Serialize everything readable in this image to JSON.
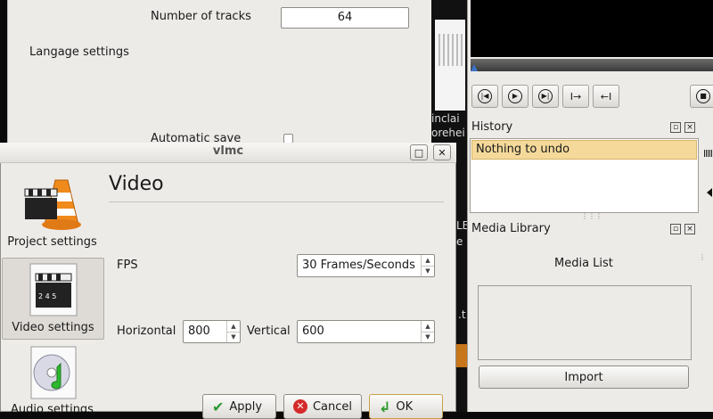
{
  "project_settings": {
    "tracks_label": "Number of tracks",
    "tracks_value": "64",
    "language_label": "Langage settings",
    "autosave_label": "Automatic save"
  },
  "background_fragments": [
    "inclai",
    "orehei",
    "LE",
    "e",
    ".t"
  ],
  "right_panel": {
    "history": {
      "title": "History",
      "items": [
        "Nothing to undo"
      ]
    },
    "media_library": {
      "title": "Media Library",
      "list_title": "Media List",
      "import_label": "Import"
    }
  },
  "dialog": {
    "title": "vlmc",
    "nav": [
      {
        "label": "Project settings"
      },
      {
        "label": "Video settings"
      },
      {
        "label": "Audio settings"
      }
    ],
    "section_title": "Video",
    "fps_label": "FPS",
    "fps_value": "30 Frames/Seconds",
    "horizontal_label": "Horizontal",
    "horizontal_value": "800",
    "vertical_label": "Vertical",
    "vertical_value": "600",
    "buttons": {
      "apply": "Apply",
      "cancel": "Cancel",
      "ok": "OK"
    }
  },
  "colors": {
    "selection": "#f5d99a",
    "accent": "#3b73c9"
  }
}
